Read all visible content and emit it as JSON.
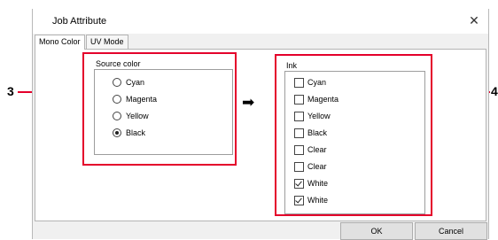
{
  "dialog": {
    "title": "Job Attribute",
    "close_glyph": "✕",
    "tabs": [
      {
        "label": "Mono Color",
        "active": true
      },
      {
        "label": "UV Mode",
        "active": false
      }
    ]
  },
  "source_color": {
    "title": "Source color",
    "options": [
      {
        "label": "Cyan",
        "selected": false
      },
      {
        "label": "Magenta",
        "selected": false
      },
      {
        "label": "Yellow",
        "selected": false
      },
      {
        "label": "Black",
        "selected": true
      }
    ]
  },
  "arrow_glyph": "➡",
  "ink": {
    "title": "Ink",
    "items": [
      {
        "label": "Cyan",
        "checked": false
      },
      {
        "label": "Magenta",
        "checked": false
      },
      {
        "label": "Yellow",
        "checked": false
      },
      {
        "label": "Black",
        "checked": false
      },
      {
        "label": "Clear",
        "checked": false
      },
      {
        "label": "Clear",
        "checked": false
      },
      {
        "label": "White",
        "checked": true
      },
      {
        "label": "White",
        "checked": true
      }
    ]
  },
  "buttons": {
    "ok": "OK",
    "cancel": "Cancel"
  },
  "callouts": {
    "left": "3",
    "right": "4"
  },
  "colors": {
    "highlight": "#e4002b"
  }
}
